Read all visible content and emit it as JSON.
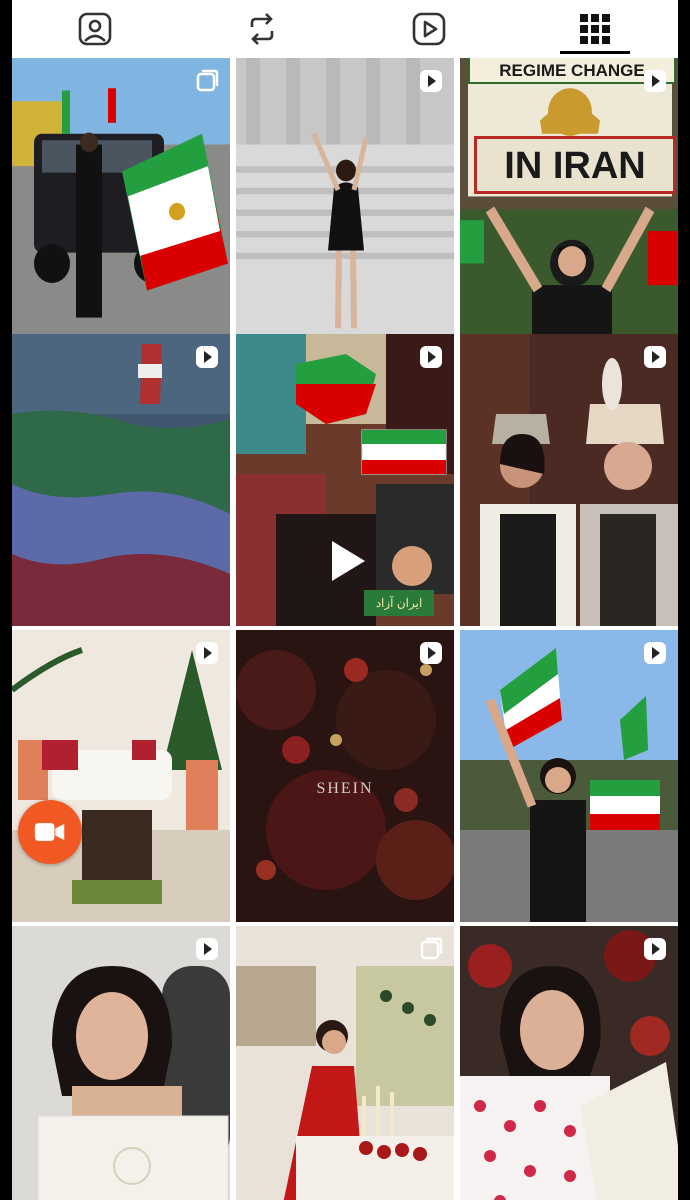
{
  "tabs": [
    {
      "name": "tagged",
      "icon": "person-tag-icon"
    },
    {
      "name": "reposts",
      "icon": "repost-icon"
    },
    {
      "name": "reels",
      "icon": "reels-icon"
    },
    {
      "name": "posts",
      "icon": "grid-icon",
      "active": true
    }
  ],
  "posts": [
    {
      "id": "protest-truck",
      "badge": "multi-icon"
    },
    {
      "id": "steps-woman",
      "badge": "reel-icon"
    },
    {
      "id": "regime-change-sign",
      "badge": "reel-icon",
      "sign_top": "REGIME CHANGE",
      "sign_bottom": "IN IRAN"
    },
    {
      "id": "flag-wave",
      "badge": "reel-icon"
    },
    {
      "id": "collage",
      "badge": "reel-icon",
      "placard": "ایران آزاد"
    },
    {
      "id": "crowned-couple",
      "badge": "reel-icon"
    },
    {
      "id": "christmas-room",
      "badge": "reel-icon"
    },
    {
      "id": "shein-tree",
      "badge": "reel-icon",
      "watermark": "SHEIN"
    },
    {
      "id": "rally-selfie",
      "badge": "reel-icon"
    },
    {
      "id": "gift-box",
      "badge": "reel-icon"
    },
    {
      "id": "red-dress",
      "badge": "multi-icon"
    },
    {
      "id": "hearts-top",
      "badge": "reel-icon"
    }
  ],
  "colors": {
    "accent_record": "#f05a22",
    "flag_green": "#239f40",
    "flag_red": "#da0000",
    "flag_white": "#ffffff"
  }
}
